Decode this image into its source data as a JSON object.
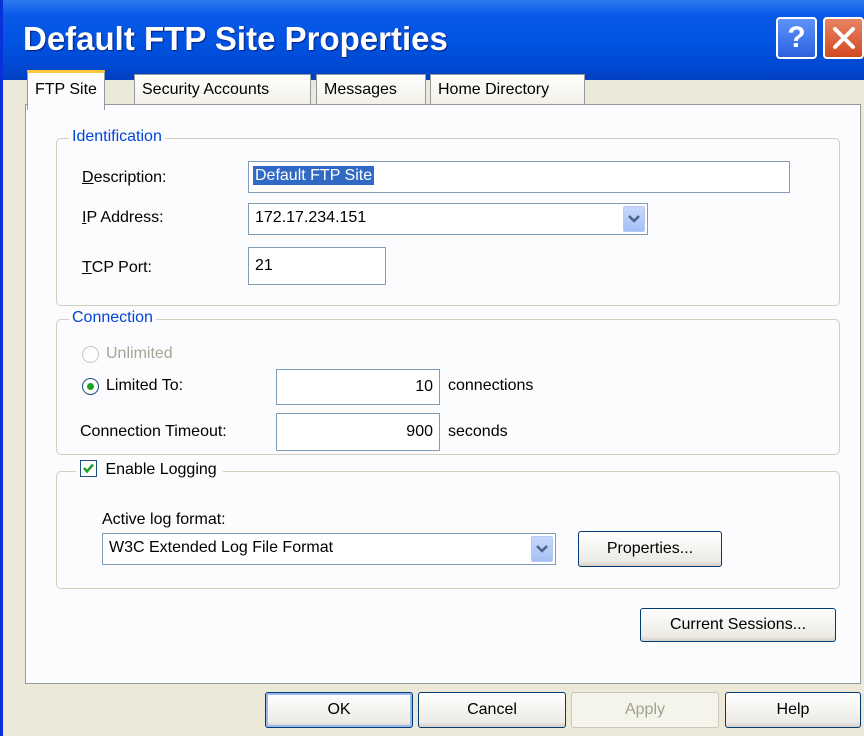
{
  "window": {
    "title": "Default FTP Site Properties",
    "help_glyph": "?",
    "colors": {
      "titlebar": "#0052E0",
      "accent": "#0046D5",
      "dialog_bg": "#ECE9D8"
    }
  },
  "tabs": [
    {
      "label": "FTP Site",
      "active": true
    },
    {
      "label": "Security Accounts",
      "active": false
    },
    {
      "label": "Messages",
      "active": false
    },
    {
      "label": "Home Directory",
      "active": false
    }
  ],
  "identification": {
    "legend": "Identification",
    "description_label": "Description:",
    "description_value": "Default FTP Site",
    "ip_label": "IP Address:",
    "ip_value": "172.17.234.151",
    "port_label": "TCP Port:",
    "port_value": "21"
  },
  "connection": {
    "legend": "Connection",
    "unlimited_label": "Unlimited",
    "limited_label": "Limited To:",
    "limited_value": "10",
    "limited_unit": "connections",
    "timeout_label": "Connection Timeout:",
    "timeout_value": "900",
    "timeout_unit": "seconds",
    "selected": "limited"
  },
  "logging": {
    "enable_label": "Enable Logging",
    "enabled": true,
    "format_label": "Active log format:",
    "format_value": "W3C Extended Log File Format",
    "properties_button": "Properties..."
  },
  "current_sessions_button": "Current Sessions...",
  "footer": {
    "ok": "OK",
    "cancel": "Cancel",
    "apply": "Apply",
    "help": "Help"
  }
}
